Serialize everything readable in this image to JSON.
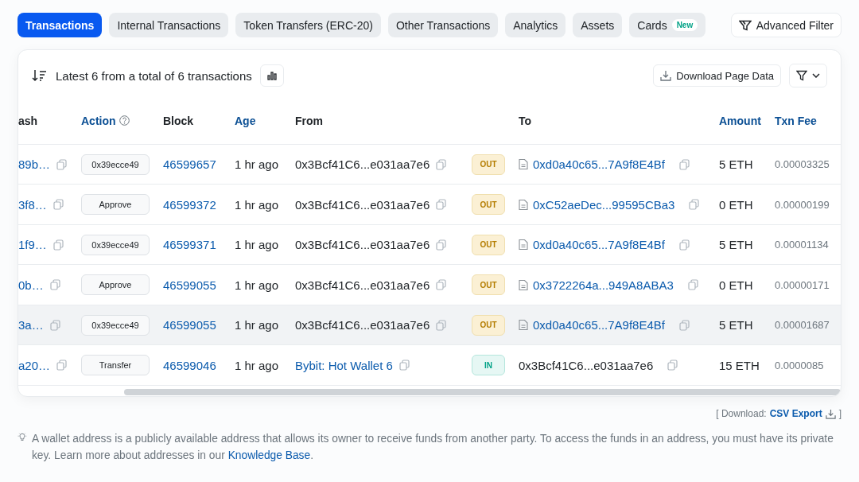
{
  "tabs": [
    {
      "label": "Transactions",
      "selected": true
    },
    {
      "label": "Internal Transactions",
      "selected": false
    },
    {
      "label": "Token Transfers (ERC-20)",
      "selected": false
    },
    {
      "label": "Other Transactions",
      "selected": false
    },
    {
      "label": "Analytics",
      "selected": false
    },
    {
      "label": "Assets",
      "selected": false
    },
    {
      "label": "Cards",
      "selected": false,
      "badge": "New"
    }
  ],
  "advanced_filter": "Advanced Filter",
  "summary": "Latest 6 from a total of 6 transactions",
  "download_button": "Download Page Data",
  "columns": [
    {
      "label": "ash",
      "link": false
    },
    {
      "label": "Action",
      "link": true,
      "help": true
    },
    {
      "label": "Block",
      "link": false
    },
    {
      "label": "Age",
      "link": true
    },
    {
      "label": "From",
      "link": false
    },
    {
      "label": "To",
      "link": false
    },
    {
      "label": "Amount",
      "link": true
    },
    {
      "label": "Txn Fee",
      "link": true
    }
  ],
  "rows": [
    {
      "hash": "89b…",
      "action": "0x39ecce49",
      "block": "46599657",
      "age": "1 hr ago",
      "from": {
        "text": "0x3Bcf41C6...e031aa7e6",
        "link": false
      },
      "direction": {
        "kind": "out",
        "label": "OUT"
      },
      "to": {
        "text": "0xd0a40c65...7A9f8E4Bf",
        "link": true,
        "contract": true
      },
      "amount": "5 ETH",
      "fee": "0.00003325",
      "hovered": false
    },
    {
      "hash": "3f8…",
      "action": "Approve",
      "block": "46599372",
      "age": "1 hr ago",
      "from": {
        "text": "0x3Bcf41C6...e031aa7e6",
        "link": false
      },
      "direction": {
        "kind": "out",
        "label": "OUT"
      },
      "to": {
        "text": "0xC52aeDec...99595CBa3",
        "link": true,
        "contract": true
      },
      "amount": "0 ETH",
      "fee": "0.00000199",
      "hovered": false
    },
    {
      "hash": "1f9…",
      "action": "0x39ecce49",
      "block": "46599371",
      "age": "1 hr ago",
      "from": {
        "text": "0x3Bcf41C6...e031aa7e6",
        "link": false
      },
      "direction": {
        "kind": "out",
        "label": "OUT"
      },
      "to": {
        "text": "0xd0a40c65...7A9f8E4Bf",
        "link": true,
        "contract": true
      },
      "amount": "5 ETH",
      "fee": "0.00001134",
      "hovered": false
    },
    {
      "hash": "0b…",
      "action": "Approve",
      "block": "46599055",
      "age": "1 hr ago",
      "from": {
        "text": "0x3Bcf41C6...e031aa7e6",
        "link": false
      },
      "direction": {
        "kind": "out",
        "label": "OUT"
      },
      "to": {
        "text": "0x3722264a...949A8ABA3",
        "link": true,
        "contract": true
      },
      "amount": "0 ETH",
      "fee": "0.00000171",
      "hovered": false
    },
    {
      "hash": "3a…",
      "action": "0x39ecce49",
      "block": "46599055",
      "age": "1 hr ago",
      "from": {
        "text": "0x3Bcf41C6...e031aa7e6",
        "link": false
      },
      "direction": {
        "kind": "out",
        "label": "OUT"
      },
      "to": {
        "text": "0xd0a40c65...7A9f8E4Bf",
        "link": true,
        "contract": true
      },
      "amount": "5 ETH",
      "fee": "0.00001687",
      "hovered": true
    },
    {
      "hash": "a20…",
      "action": "Transfer",
      "block": "46599046",
      "age": "1 hr ago",
      "from": {
        "text": "Bybit: Hot Wallet 6",
        "link": true
      },
      "direction": {
        "kind": "in",
        "label": "IN"
      },
      "to": {
        "text": "0x3Bcf41C6...e031aa7e6",
        "link": false,
        "contract": false
      },
      "amount": "15 ETH",
      "fee": "0.0000085",
      "hovered": false
    }
  ],
  "export": {
    "open": "[ Download:",
    "link": "CSV Export",
    "close": "]"
  },
  "note": {
    "text": "A wallet address is a publicly available address that allows its owner to receive funds from another party. To access the funds in an address, you must have its private key. Learn more about addresses in our",
    "link": "Knowledge Base",
    "end": "."
  }
}
